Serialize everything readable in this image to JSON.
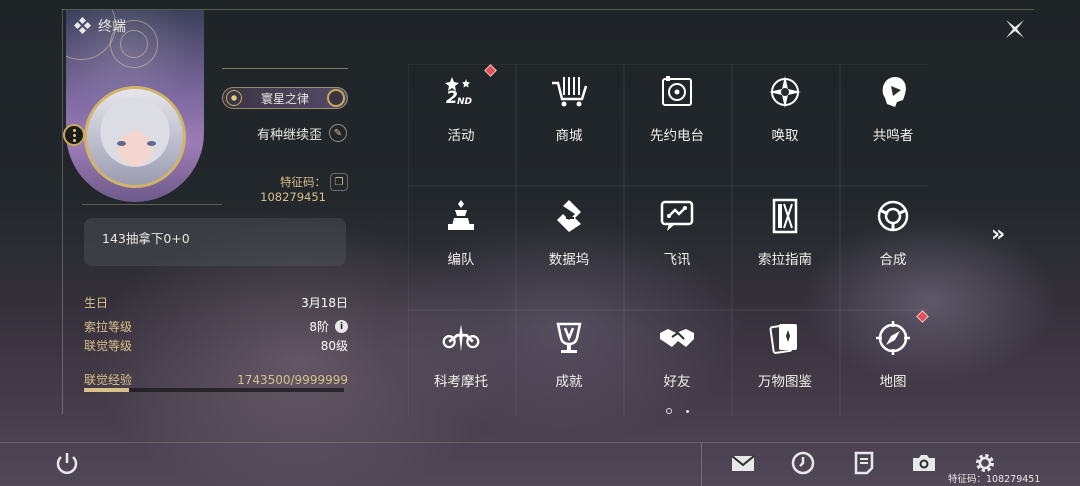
{
  "header": {
    "title": "终端"
  },
  "profile": {
    "badge_title": "寰星之律",
    "username": "有种继续歪",
    "uid_label": "特征码：108279451",
    "signature": "143抽拿下0+0"
  },
  "stats": {
    "birthday_label": "生日",
    "birthday_value": "3月18日",
    "sola_level_label": "索拉等级",
    "sola_level_value": "8阶",
    "union_level_label": "联觉等级",
    "union_level_value": "80级",
    "union_exp_label": "联觉经验",
    "union_exp_value": "1743500/9999999",
    "union_exp_fraction": 0.174
  },
  "menu": {
    "items": [
      {
        "label": "活动",
        "icon": "activity-2nd-icon",
        "badge": true
      },
      {
        "label": "商城",
        "icon": "shop-cart-icon",
        "badge": false
      },
      {
        "label": "先约电台",
        "icon": "radio-icon",
        "badge": false
      },
      {
        "label": "唤取",
        "icon": "convene-icon",
        "badge": false
      },
      {
        "label": "共鸣者",
        "icon": "resonator-icon",
        "badge": false
      },
      {
        "label": "编队",
        "icon": "team-icon",
        "badge": false
      },
      {
        "label": "数据坞",
        "icon": "data-dock-icon",
        "badge": false
      },
      {
        "label": "飞讯",
        "icon": "message-icon",
        "badge": false
      },
      {
        "label": "索拉指南",
        "icon": "guidebook-icon",
        "badge": false
      },
      {
        "label": "合成",
        "icon": "synthesis-icon",
        "badge": false
      },
      {
        "label": "科考摩托",
        "icon": "motorcycle-icon",
        "badge": false
      },
      {
        "label": "成就",
        "icon": "achievement-icon",
        "badge": false
      },
      {
        "label": "好友",
        "icon": "friends-icon",
        "badge": false
      },
      {
        "label": "万物图鉴",
        "icon": "archive-cards-icon",
        "badge": false
      },
      {
        "label": "地图",
        "icon": "map-compass-icon",
        "badge": true
      }
    ],
    "current_page": 1,
    "total_pages": 2
  },
  "footer": {
    "uid_label": "特征码：108279451",
    "buttons": [
      "mail-icon",
      "clock-icon",
      "notes-icon",
      "camera-icon",
      "settings-gear-icon"
    ]
  },
  "colors": {
    "accent_gold": "#d9c08a",
    "badge_red": "#e0505a",
    "text_light": "#f2f0ea"
  }
}
